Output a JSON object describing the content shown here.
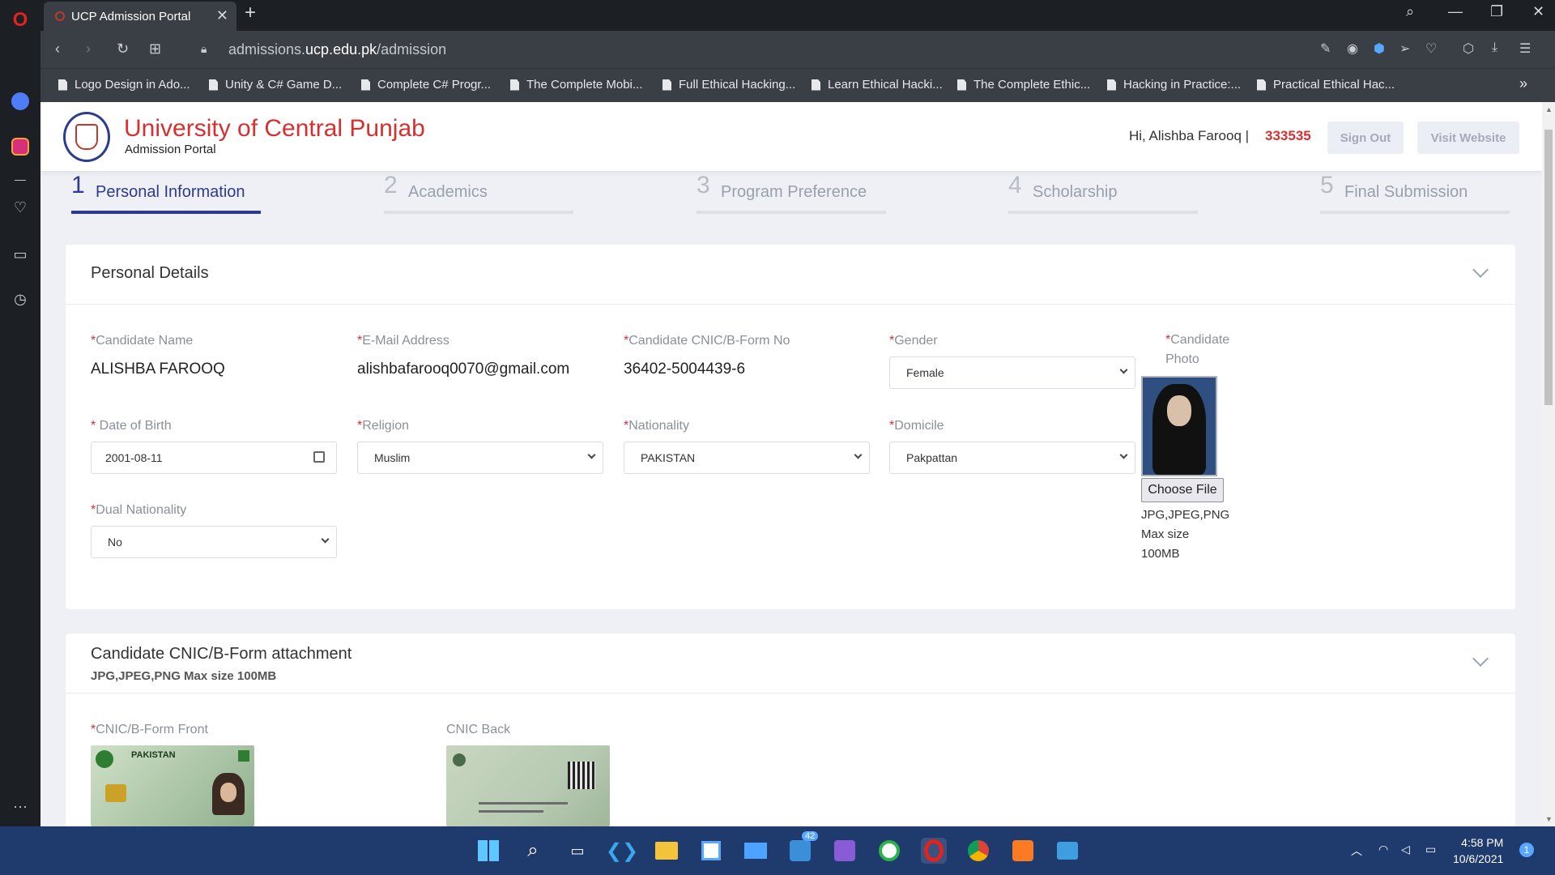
{
  "browser": {
    "tab_title": "UCP Admission Portal",
    "url_prefix": "admissions.",
    "url_domain": "ucp.edu.pk",
    "url_path": "/admission",
    "bookmarks": [
      "Logo Design in Ado...",
      "Unity & C# Game D...",
      "Complete C# Progr...",
      "The Complete Mobi...",
      "Full Ethical Hacking...",
      "Learn Ethical Hacki...",
      "The Complete Ethic...",
      "Hacking in Practice:...",
      "Practical Ethical Hac..."
    ]
  },
  "header": {
    "university": "University of Central Punjab",
    "portal": "Admission Portal",
    "greeting": "Hi, Alishba Farooq |",
    "application_no": "333535",
    "sign_out": "Sign Out",
    "visit_website": "Visit Website"
  },
  "steps": [
    {
      "num": "1",
      "label": "Personal Information",
      "active": true
    },
    {
      "num": "2",
      "label": "Academics",
      "active": false
    },
    {
      "num": "3",
      "label": "Program Preference",
      "active": false
    },
    {
      "num": "4",
      "label": "Scholarship",
      "active": false
    },
    {
      "num": "5",
      "label": "Final Submission",
      "active": false
    }
  ],
  "personal": {
    "title": "Personal Details",
    "name_label": "Candidate Name",
    "name_value": "ALISHBA FAROOQ",
    "email_label": "E-Mail Address",
    "email_value": "alishbafarooq0070@gmail.com",
    "cnic_label": "Candidate CNIC/B-Form No",
    "cnic_value": "36402-5004439-6",
    "gender_label": "Gender",
    "gender_value": "Female",
    "photo_label_1": "Candidate",
    "photo_label_2": "Photo",
    "dob_label": " Date of Birth",
    "dob_value": "2001-08-11",
    "religion_label": "Religion",
    "religion_value": "Muslim",
    "nationality_label": "Nationality",
    "nationality_value": "PAKISTAN",
    "domicile_label": "Domicile",
    "domicile_value": "Pakpattan",
    "dual_label": "Dual Nationality",
    "dual_value": "No",
    "choose_file": "Choose File",
    "photo_hint_1": "JPG,JPEG,PNG",
    "photo_hint_2": "Max size",
    "photo_hint_3": "100MB",
    "required_mark": "*"
  },
  "attachment": {
    "title": "Candidate CNIC/B-Form attachment",
    "subtitle": "JPG,JPEG,PNG Max size 100MB",
    "front_label": "CNIC/B-Form Front",
    "back_label": "CNIC Back",
    "card_country": "PAKISTAN"
  },
  "taskbar": {
    "badge": "42",
    "time": "4:58 PM",
    "date": "10/6/2021",
    "notif": "1"
  }
}
